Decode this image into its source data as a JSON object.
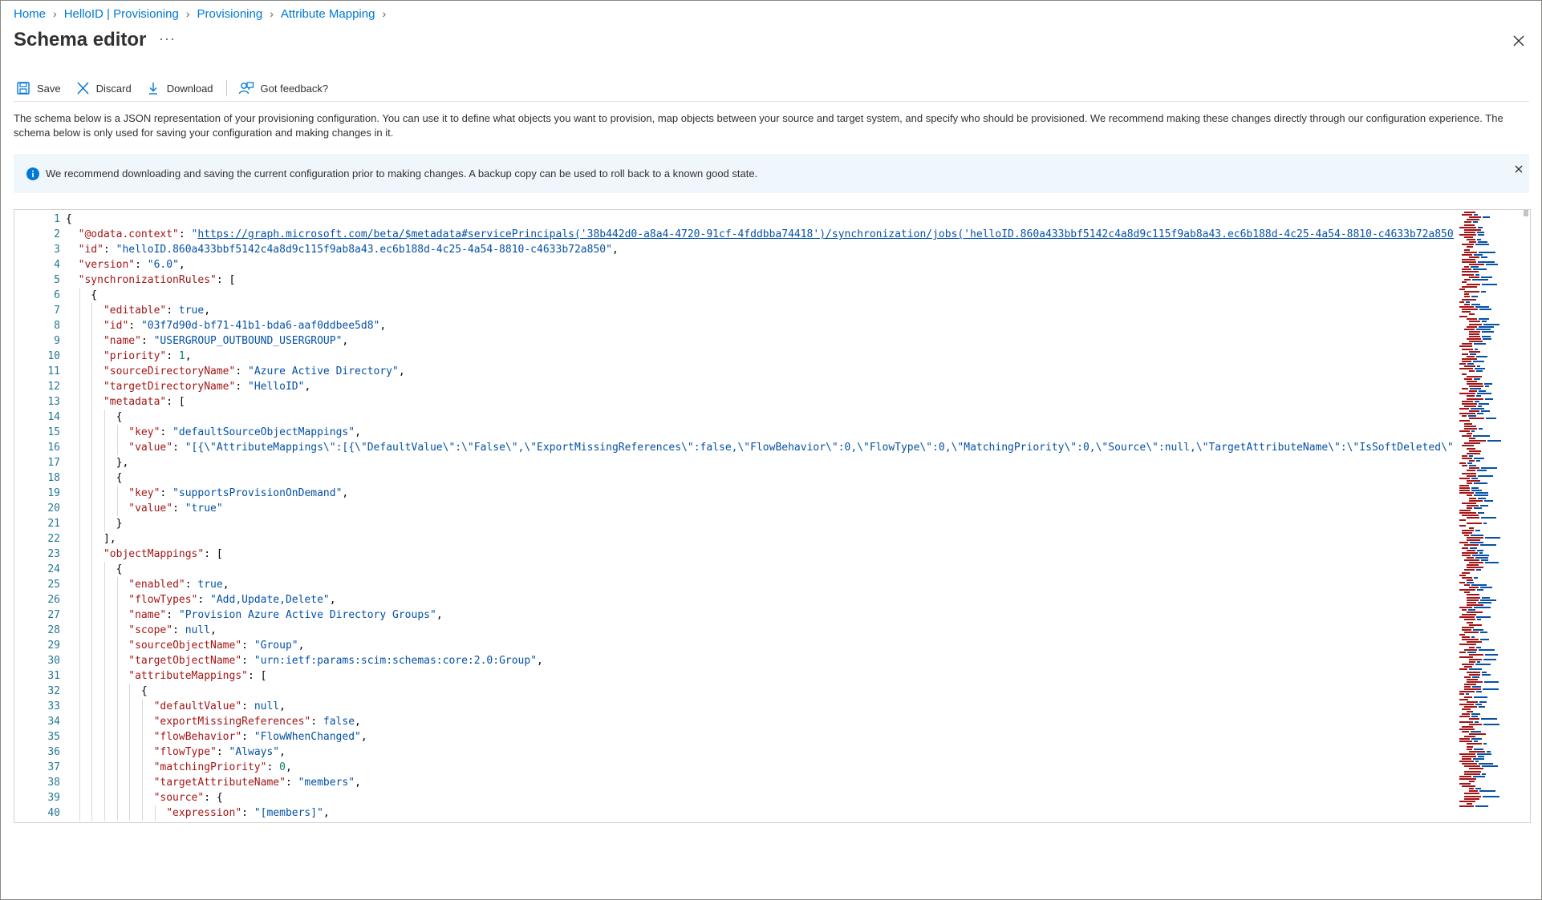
{
  "breadcrumb": [
    {
      "label": "Home"
    },
    {
      "label": "HelloID | Provisioning"
    },
    {
      "label": "Provisioning"
    },
    {
      "label": "Attribute Mapping"
    }
  ],
  "page": {
    "title": "Schema editor",
    "more": "···"
  },
  "toolbar": {
    "save_label": "Save",
    "discard_label": "Discard",
    "download_label": "Download",
    "feedback_label": "Got feedback?"
  },
  "description": "The schema below is a JSON representation of your provisioning configuration. You can use it to define what objects you want to provision, map objects between your source and target system, and specify who should be provisioned. We recommend making these changes directly through our configuration experience. The schema below is only used for saving your configuration and making changes in it.",
  "banner": {
    "text": "We recommend downloading and saving the current configuration prior to making changes. A backup copy can be used to roll back to a known good state."
  },
  "editor": {
    "lines": [
      "{",
      "  \"@odata.context\": \"https://graph.microsoft.com/beta/$metadata#servicePrincipals('38b442d0-a8a4-4720-91cf-4fddbba74418')/synchronization/jobs('helloID.860a433bbf5142c4a8d9c115f9ab8a43.ec6b188d-4c25-4a54-8810-c4633b72a850'",
      "  \"id\": \"helloID.860a433bbf5142c4a8d9c115f9ab8a43.ec6b188d-4c25-4a54-8810-c4633b72a850\",",
      "  \"version\": \"6.0\",",
      "  \"synchronizationRules\": [",
      "    {",
      "      \"editable\": true,",
      "      \"id\": \"03f7d90d-bf71-41b1-bda6-aaf0ddbee5d8\",",
      "      \"name\": \"USERGROUP_OUTBOUND_USERGROUP\",",
      "      \"priority\": 1,",
      "      \"sourceDirectoryName\": \"Azure Active Directory\",",
      "      \"targetDirectoryName\": \"HelloID\",",
      "      \"metadata\": [",
      "        {",
      "          \"key\": \"defaultSourceObjectMappings\",",
      "          \"value\": \"[{\\\"AttributeMappings\\\":[{\\\"DefaultValue\\\":\\\"False\\\",\\\"ExportMissingReferences\\\":false,\\\"FlowBehavior\\\":0,\\\"FlowType\\\":0,\\\"MatchingPriority\\\":0,\\\"Source\\\":null,\\\"TargetAttributeName\\\":\\\"IsSoftDeleted\\\"}",
      "        },",
      "        {",
      "          \"key\": \"supportsProvisionOnDemand\",",
      "          \"value\": \"true\"",
      "        }",
      "      ],",
      "      \"objectMappings\": [",
      "        {",
      "          \"enabled\": true,",
      "          \"flowTypes\": \"Add,Update,Delete\",",
      "          \"name\": \"Provision Azure Active Directory Groups\",",
      "          \"scope\": null,",
      "          \"sourceObjectName\": \"Group\",",
      "          \"targetObjectName\": \"urn:ietf:params:scim:schemas:core:2.0:Group\",",
      "          \"attributeMappings\": [",
      "            {",
      "              \"defaultValue\": null,",
      "              \"exportMissingReferences\": false,",
      "              \"flowBehavior\": \"FlowWhenChanged\",",
      "              \"flowType\": \"Always\",",
      "              \"matchingPriority\": 0,",
      "              \"targetAttributeName\": \"members\",",
      "              \"source\": {",
      "                \"expression\": \"[members]\","
    ]
  },
  "colors": {
    "link": "#0078d4",
    "json_key": "#a31515",
    "json_string": "#0451a5",
    "json_number": "#098658",
    "line_number": "#237893",
    "banner_bg": "#eff6fc"
  }
}
